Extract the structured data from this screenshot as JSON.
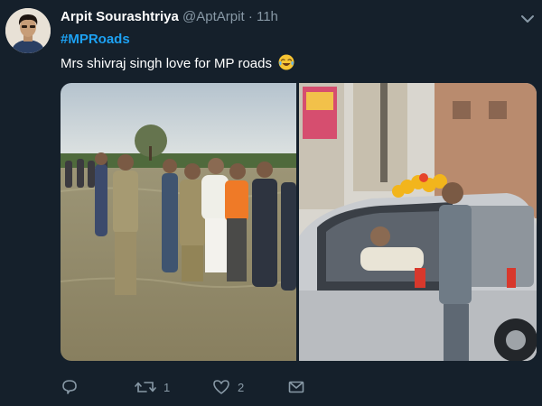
{
  "tweet": {
    "author_name": "Arpit Sourashtriya",
    "handle": "@AptArpit",
    "separator": "·",
    "time": "11h",
    "hashtag": "#MPRoads",
    "text": "Mrs shivraj singh love for MP roads",
    "emoji": "face-with-tears-of-joy-icon"
  },
  "media": [
    {
      "name": "flood-photo",
      "description_icon": "photo"
    },
    {
      "name": "car-photo",
      "description_icon": "photo"
    }
  ],
  "actions": {
    "reply_count": "",
    "retweet_count": "1",
    "like_count": "2"
  },
  "colors": {
    "background": "#15202b",
    "accent": "#1da1f2",
    "secondary_text": "#8899a6"
  }
}
